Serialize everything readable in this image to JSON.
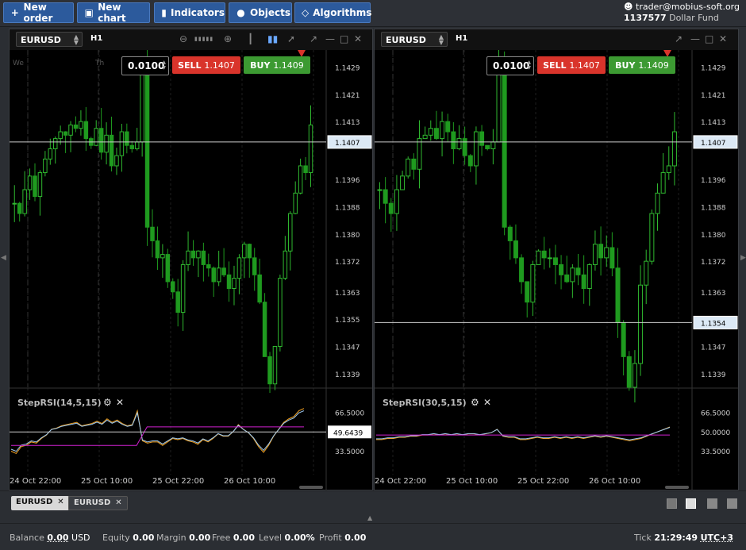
{
  "toolbar": {
    "new_order": "New order",
    "new_chart": "New chart",
    "indicators": "Indicators",
    "objects": "Objects",
    "algorithms": "Algorithms"
  },
  "account": {
    "user": "trader@mobius-soft.org",
    "number": "1137577",
    "name": "Dollar Fund"
  },
  "charts": [
    {
      "symbol": "EURUSD",
      "timeframe": "H1",
      "lot": "0.0100",
      "sell_label": "SELL",
      "sell_price": "1.1407",
      "buy_label": "BUY",
      "buy_price": "1.1409",
      "day_labels": [
        "We",
        "Th"
      ],
      "price_ticks": [
        "1.1429",
        "1.1421",
        "1.1413",
        "1.1396",
        "1.1388",
        "1.1380",
        "1.1372",
        "1.1363",
        "1.1355",
        "1.1347",
        "1.1339"
      ],
      "price_marker": "1.1407",
      "indicator_name": "StepRSI(14,5,15)",
      "rsi_ticks": [
        "66.5000",
        "33.5000"
      ],
      "rsi_marker": "49.6439",
      "time_ticks": [
        "24 Oct 22:00",
        "25 Oct 10:00",
        "25 Oct 22:00",
        "26 Oct 10:00"
      ]
    },
    {
      "symbol": "EURUSD",
      "timeframe": "H1",
      "lot": "0.0100",
      "sell_label": "SELL",
      "sell_price": "1.1407",
      "buy_label": "BUY",
      "buy_price": "1.1409",
      "price_ticks": [
        "1.1429",
        "1.1421",
        "1.1413",
        "1.1396",
        "1.1388",
        "1.1380",
        "1.1372",
        "1.1363",
        "1.1355",
        "1.1347",
        "1.1339"
      ],
      "price_marker": "1.1407",
      "price_marker2": "1.1354",
      "indicator_name": "StepRSI(30,5,15)",
      "rsi_ticks": [
        "66.5000",
        "50.0000",
        "33.5000"
      ],
      "time_ticks": [
        "24 Oct 22:00",
        "25 Oct 10:00",
        "25 Oct 22:00",
        "26 Oct 10:00"
      ]
    }
  ],
  "tabs": [
    {
      "label": "EURUSD",
      "active": true
    },
    {
      "label": "EURUSD",
      "active": false
    }
  ],
  "status": {
    "balance_label": "Balance",
    "balance": "0.00",
    "currency": "USD",
    "equity_label": "Equity",
    "equity": "0.00",
    "margin_label": "Margin",
    "margin": "0.00",
    "free_label": "Free",
    "free": "0.00",
    "level_label": "Level",
    "level": "0.00%",
    "profit_label": "Profit",
    "profit": "0.00",
    "tick_label": "Tick",
    "time": "21:29:49",
    "tz": "UTC+3"
  },
  "colors": {
    "bull": "#2fb82f",
    "bear": "#1f9a1f",
    "rsi_orange": "#f0a020",
    "rsi_blue": "#9cc8f0",
    "rsi_magenta": "#d020d0"
  }
}
